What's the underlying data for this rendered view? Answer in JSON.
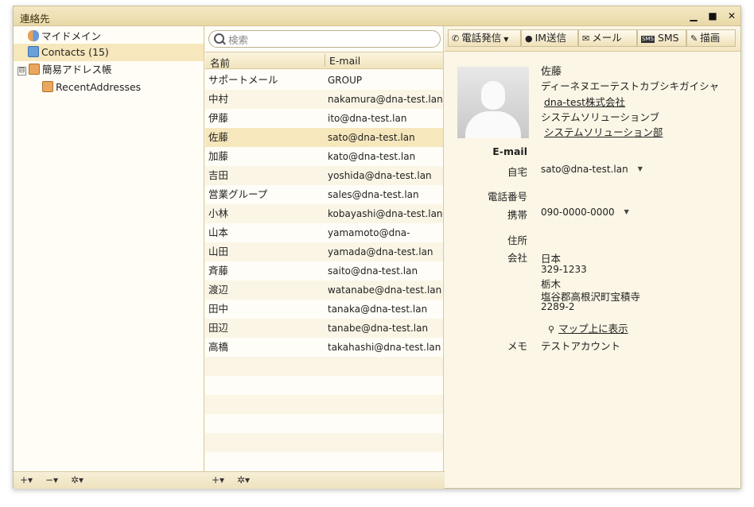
{
  "window": {
    "title": "連絡先"
  },
  "sidebar": {
    "items": [
      {
        "label": "マイドメイン"
      },
      {
        "label": "Contacts (15)"
      },
      {
        "label": "簡易アドレス帳",
        "expander": "⊟"
      },
      {
        "label": "RecentAddresses"
      }
    ]
  },
  "search": {
    "placeholder": "検索"
  },
  "contact_list": {
    "columns": [
      "名前",
      "E-mail"
    ],
    "rows": [
      {
        "name": "サポートメール",
        "email": "GROUP"
      },
      {
        "name": "中村",
        "email": "nakamura@dna-test.lan"
      },
      {
        "name": "伊藤",
        "email": "ito@dna-test.lan"
      },
      {
        "name": "佐藤",
        "email": "sato@dna-test.lan"
      },
      {
        "name": "加藤",
        "email": "kato@dna-test.lan"
      },
      {
        "name": "吉田",
        "email": "yoshida@dna-test.lan"
      },
      {
        "name": "営業グループ",
        "email": "sales@dna-test.lan"
      },
      {
        "name": "小林",
        "email": "kobayashi@dna-test.lan"
      },
      {
        "name": "山本",
        "email": "yamamoto@dna-test.lan"
      },
      {
        "name": "山田",
        "email": "yamada@dna-test.lan"
      },
      {
        "name": "斉藤",
        "email": "saito@dna-test.lan"
      },
      {
        "name": "渡辺",
        "email": "watanabe@dna-test.lan"
      },
      {
        "name": "田中",
        "email": "tanaka@dna-test.lan"
      },
      {
        "name": "田辺",
        "email": "tanabe@dna-test.lan"
      },
      {
        "name": "高橋",
        "email": "takahashi@dna-test.lan"
      }
    ]
  },
  "toolbar": {
    "call": "電話発信",
    "im": "IM送信",
    "mail": "メール",
    "sms": "SMS",
    "draw": "描画"
  },
  "details": {
    "name": "佐藤",
    "company_kana": "ディーネヌエーテストカブシキガイシャ",
    "company": "dna-test株式会社",
    "department_kana": "システムソリューションブ",
    "department": "システムソリューション部",
    "email_heading": "E-mail",
    "email_home_label": "自宅",
    "email_home": "sato@dna-test.lan",
    "phone_heading": "電話番号",
    "phone_mobile_label": "携帯",
    "phone_mobile": "090-0000-0000",
    "address_heading": "住所",
    "address_work_label": "会社",
    "country": "日本",
    "postal": "329-1233",
    "prefecture": "栃木",
    "city": "塩谷郡高根沢町宝積寺",
    "street": "2289-2",
    "map_link": "マップ上に表示",
    "memo_label": "メモ",
    "memo": "テストアカウント"
  },
  "bottom_left": {
    "add": "+▾",
    "remove": "−▾",
    "settings": "✲▾"
  },
  "bottom_mid": {
    "add": "+▾",
    "settings": "✲▾"
  },
  "colors": {
    "selected_row": "#f6e7bc",
    "pane_bg": "#fbf6e6"
  }
}
